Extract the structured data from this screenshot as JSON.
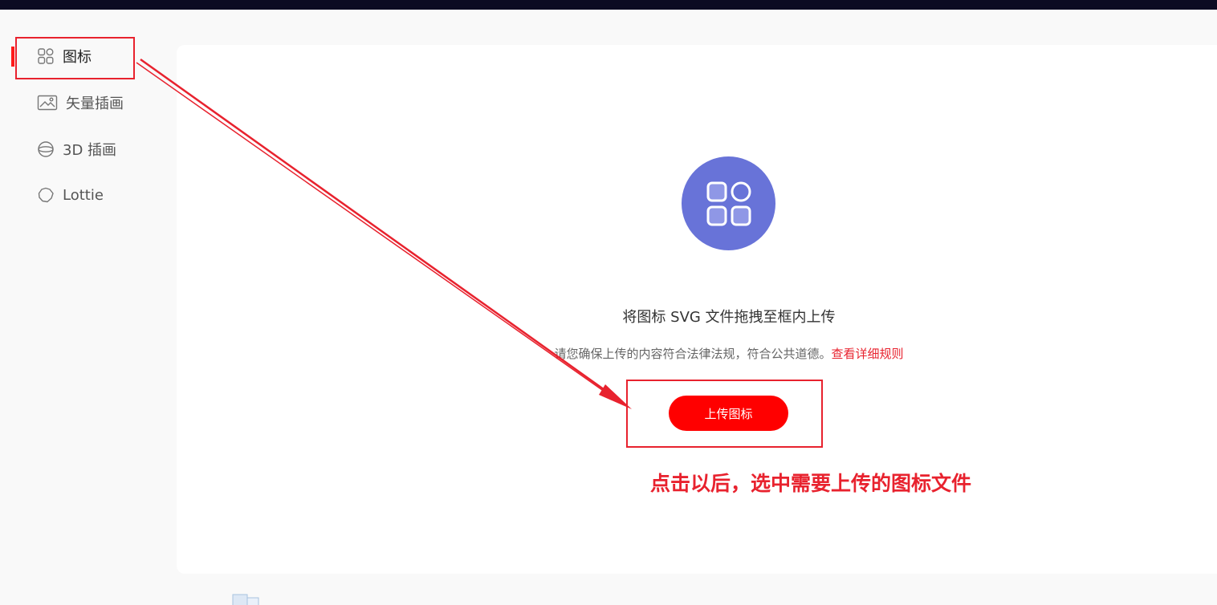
{
  "sidebar": {
    "items": [
      {
        "label": "图标",
        "icon": "grid-icon",
        "active": true
      },
      {
        "label": "矢量插画",
        "icon": "image-icon",
        "active": false
      },
      {
        "label": "3D 插画",
        "icon": "sphere-icon",
        "active": false
      },
      {
        "label": "Lottie",
        "icon": "lottie-icon",
        "active": false
      }
    ]
  },
  "upload": {
    "title": "将图标 SVG 文件拖拽至框内上传",
    "notice": "请您确保上传的内容符合法律法规，符合公共道德。",
    "rules_link": "查看详细规则",
    "button_label": "上传图标",
    "hero_icon": "icon-grid-icon"
  },
  "annotation": {
    "text": "点击以后，选中需要上传的图标文件"
  },
  "colors": {
    "accent": "#ff0000",
    "annotation": "#e8222e",
    "hero": "#6873d8",
    "topbar": "#0c0b22"
  }
}
